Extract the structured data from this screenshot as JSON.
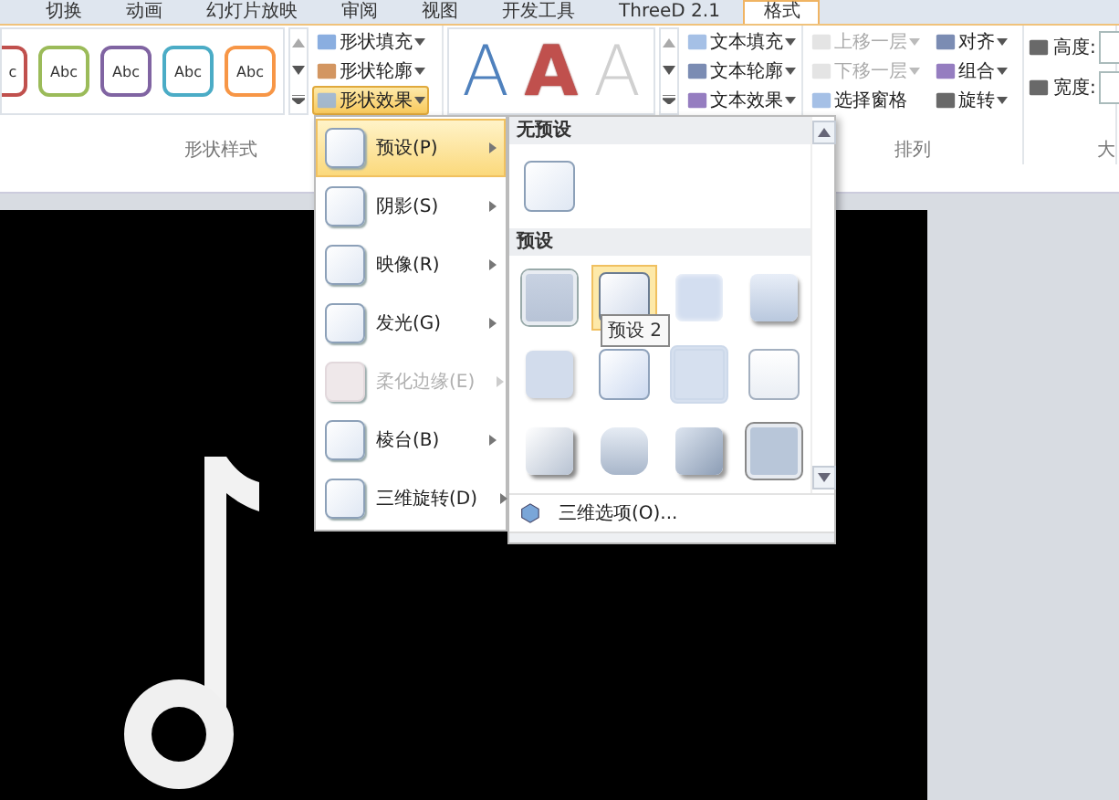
{
  "tabs": [
    {
      "label": "切换",
      "selected": false
    },
    {
      "label": "动画",
      "selected": false
    },
    {
      "label": "幻灯片放映",
      "selected": false
    },
    {
      "label": "审阅",
      "selected": false
    },
    {
      "label": "视图",
      "selected": false
    },
    {
      "label": "开发工具",
      "selected": false
    },
    {
      "label": "ThreeD 2.1",
      "selected": false
    },
    {
      "label": "格式",
      "selected": true
    }
  ],
  "shape_styles": {
    "thumbnails": [
      {
        "label": "c",
        "color": "#c0504d"
      },
      {
        "label": "Abc",
        "color": "#9bbb59"
      },
      {
        "label": "Abc",
        "color": "#8064a2"
      },
      {
        "label": "Abc",
        "color": "#4bacc6"
      },
      {
        "label": "Abc",
        "color": "#f79646"
      }
    ],
    "buttons": [
      {
        "label": "形状填充",
        "active": false
      },
      {
        "label": "形状轮廓",
        "active": false
      },
      {
        "label": "形状效果",
        "active": true
      }
    ],
    "group_label": "形状样式"
  },
  "wordart_styles": {
    "letters": [
      {
        "label": "A",
        "kind": "outline",
        "color": "#4f81bd"
      },
      {
        "label": "A",
        "kind": "filled",
        "color": "#c0504d"
      },
      {
        "label": "A",
        "kind": "outline",
        "color": "#d0d0d0"
      }
    ],
    "buttons": [
      {
        "label": "文本填充"
      },
      {
        "label": "文本轮廓"
      },
      {
        "label": "文本效果"
      }
    ]
  },
  "arrange": {
    "columns": [
      [
        {
          "label": "上移一层",
          "disabled": true,
          "dropdown": true
        },
        {
          "label": "下移一层",
          "disabled": true,
          "dropdown": true
        },
        {
          "label": "选择窗格",
          "disabled": false,
          "dropdown": false
        }
      ],
      [
        {
          "label": "对齐",
          "disabled": false,
          "dropdown": true
        },
        {
          "label": "组合",
          "disabled": false,
          "dropdown": true
        },
        {
          "label": "旋转",
          "disabled": false,
          "dropdown": true
        }
      ]
    ],
    "group_label": "排列"
  },
  "size": {
    "fields": [
      {
        "label": "高度:"
      },
      {
        "label": "宽度:"
      }
    ],
    "group_label": "大"
  },
  "effects_menu": {
    "items": [
      {
        "label": "预设(P)",
        "selected": true,
        "disabled": false
      },
      {
        "label": "阴影(S)",
        "selected": false,
        "disabled": false
      },
      {
        "label": "映像(R)",
        "selected": false,
        "disabled": false
      },
      {
        "label": "发光(G)",
        "selected": false,
        "disabled": false
      },
      {
        "label": "柔化边缘(E)",
        "selected": false,
        "disabled": true
      },
      {
        "label": "棱台(B)",
        "selected": false,
        "disabled": false
      },
      {
        "label": "三维旋转(D)",
        "selected": false,
        "disabled": false
      }
    ]
  },
  "preset_submenu": {
    "no_preset_header": "无预设",
    "preset_header": "预设",
    "presets": [
      {
        "selected": false
      },
      {
        "selected": true
      },
      {
        "selected": false
      },
      {
        "selected": false
      },
      {
        "selected": false
      },
      {
        "selected": false
      },
      {
        "selected": false
      },
      {
        "selected": false
      },
      {
        "selected": false
      },
      {
        "selected": false
      },
      {
        "selected": false
      },
      {
        "selected": false
      }
    ],
    "tooltip": "预设 2",
    "options": "三维选项(O)..."
  }
}
